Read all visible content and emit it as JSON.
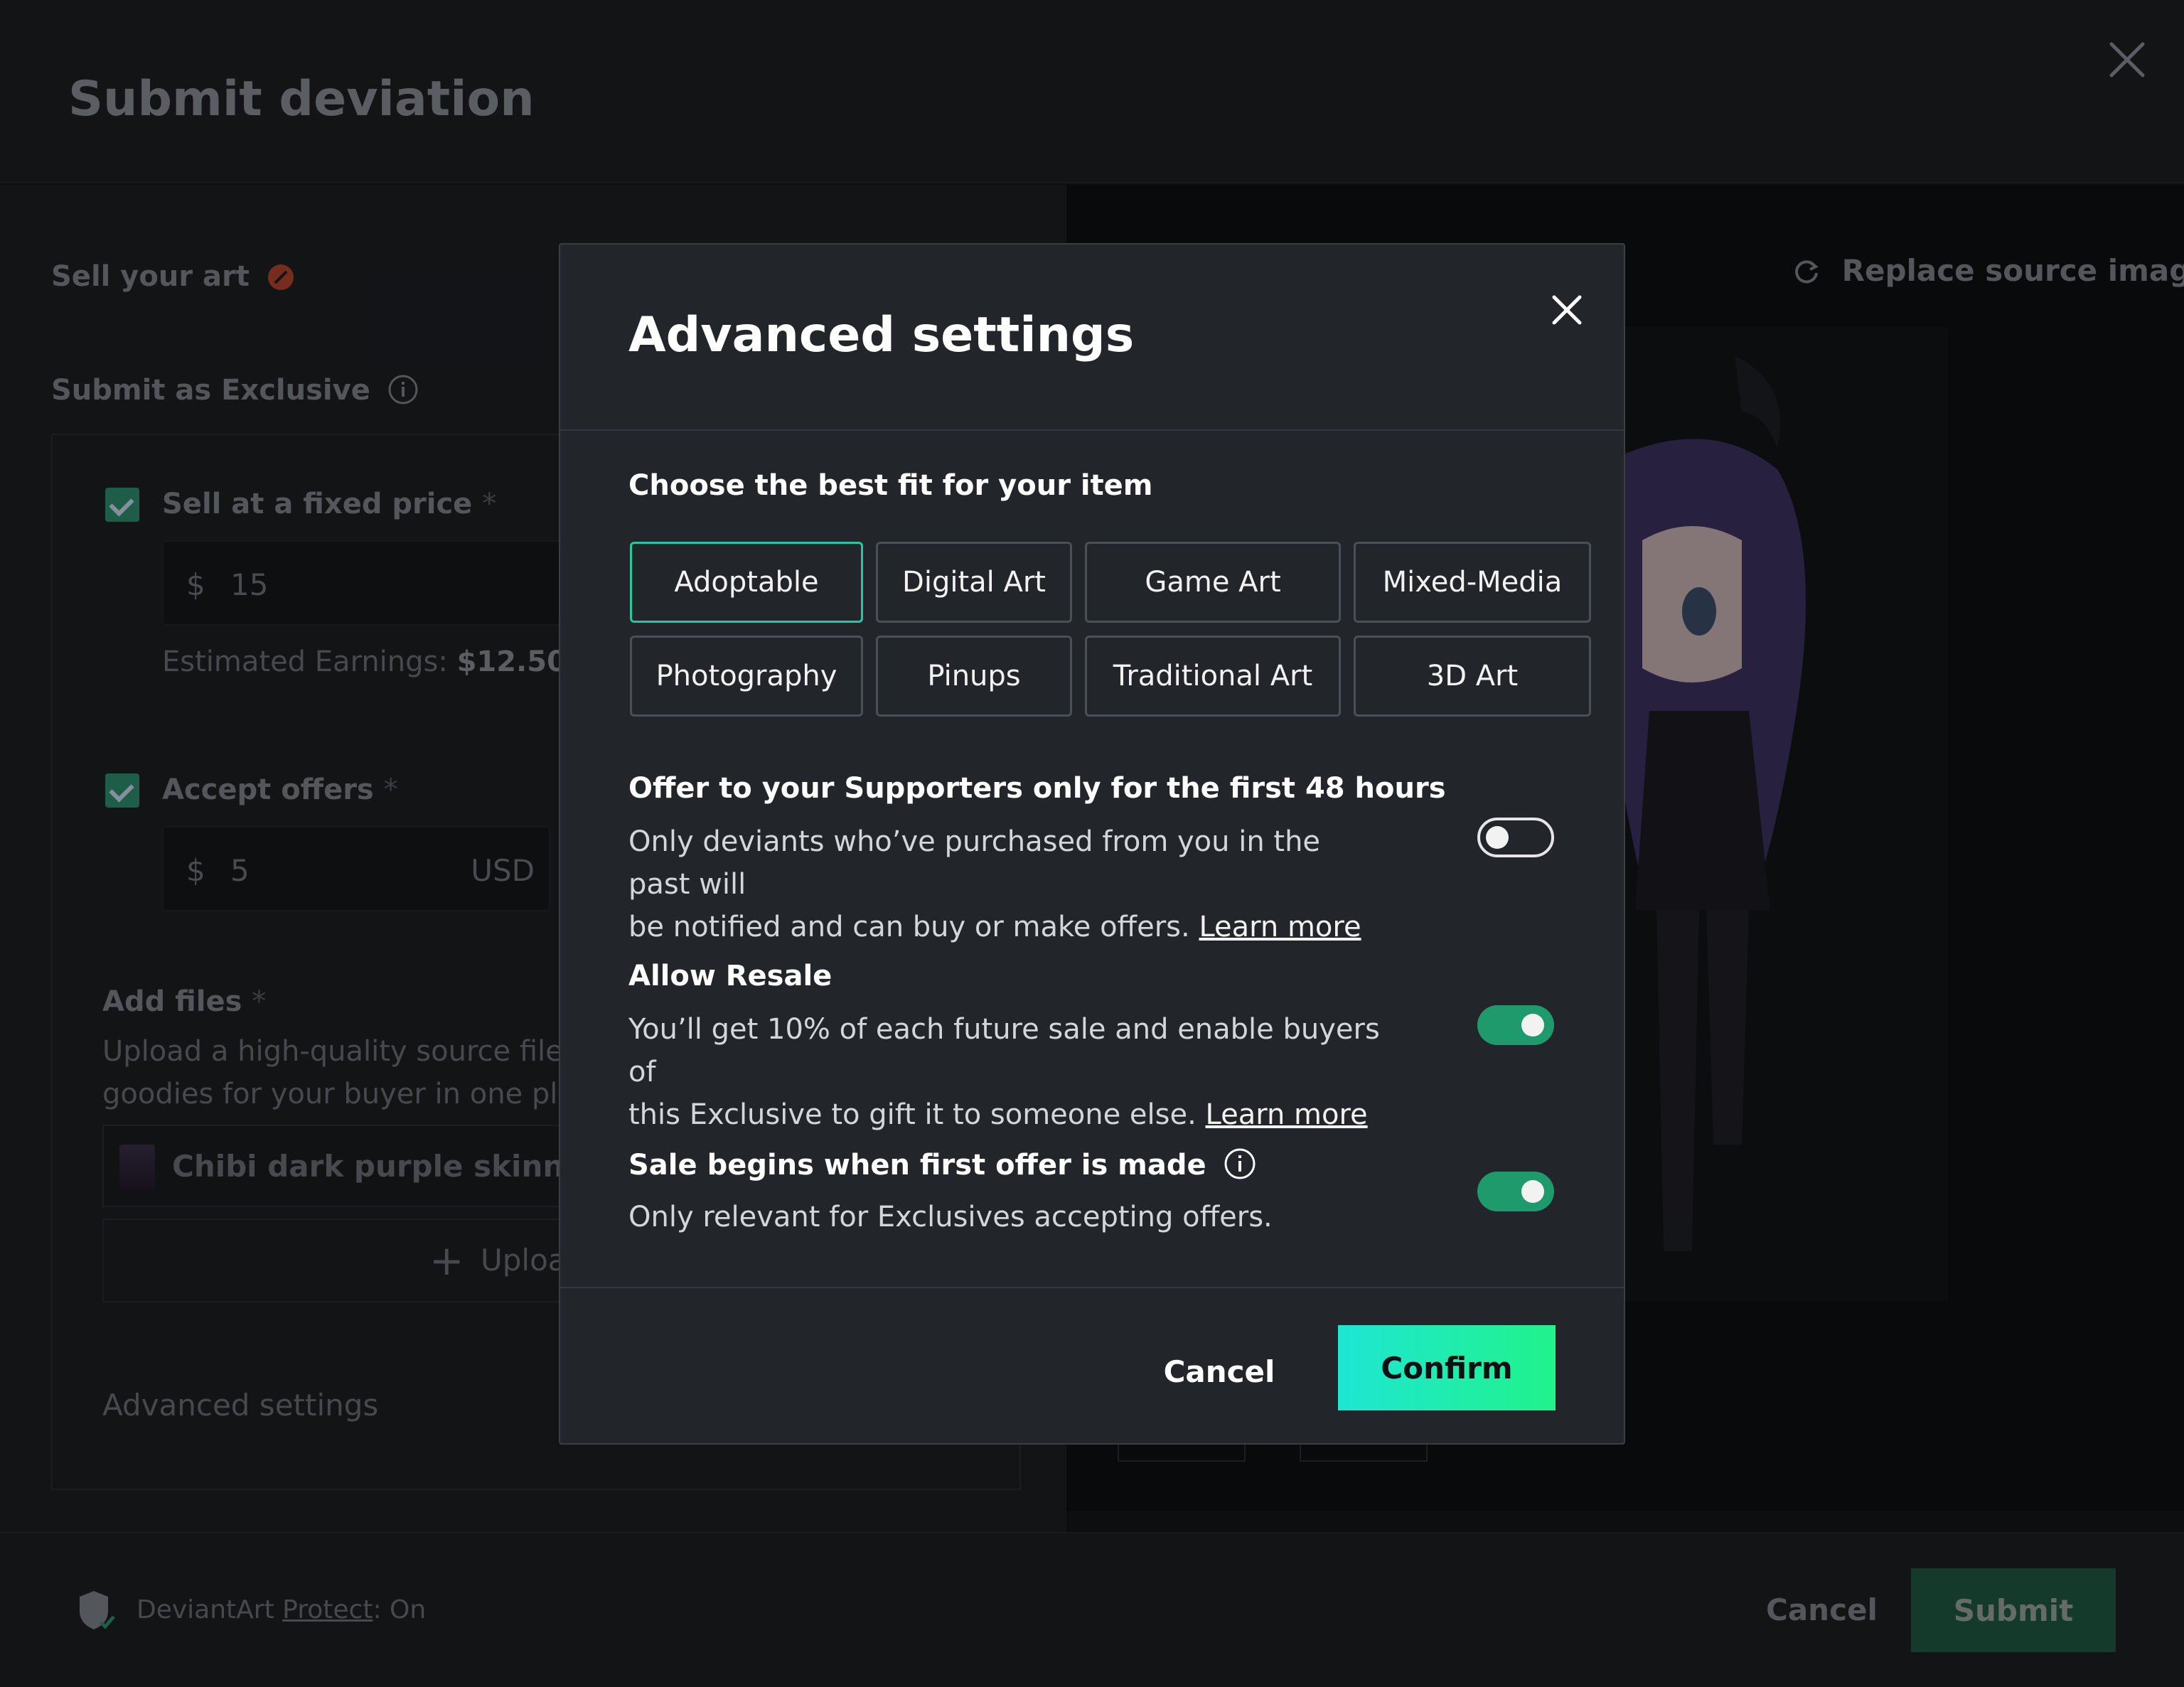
{
  "page": {
    "title": "Submit deviation",
    "sell_label": "Sell your art",
    "exclusive_label": "Submit as Exclusive",
    "fixed_price_label": "Sell at a fixed price",
    "price_currency": "$",
    "price_value": "15",
    "earnings_label": "Estimated Earnings:",
    "earnings_value": "$12.50",
    "offers_label": "Accept offers",
    "offer_currency": "$",
    "offer_value": "5",
    "offer_unit": "USD",
    "required_mark": "*",
    "add_files_label": "Add files",
    "add_files_desc_1": "Upload a high-quality source file li",
    "add_files_desc_2": "goodies for your buyer in one plac",
    "file_name": "Chibi dark purple skinned de",
    "upload_label": "Uploa",
    "advanced_link": "Advanced settings",
    "replace_label": "Replace source image",
    "protect_prefix": "DeviantArt",
    "protect_link": "Protect",
    "protect_suffix": ": On",
    "footer_cancel": "Cancel",
    "footer_submit": "Submit"
  },
  "modal": {
    "title": "Advanced settings",
    "category_heading": "Choose the best fit for your item",
    "categories": [
      "Adoptable",
      "Digital Art",
      "Game Art",
      "Mixed-Media",
      "Photography",
      "Pinups",
      "Traditional Art",
      "3D Art"
    ],
    "selected_category": "Adoptable",
    "options": [
      {
        "title": "Offer to your Supporters only for the first 48 hours",
        "desc_1": "Only deviants who’ve purchased from you in the past will",
        "desc_2": "be notified and can buy or make offers.",
        "link": "Learn more",
        "enabled": false
      },
      {
        "title": "Allow Resale",
        "desc_1": "You’ll get 10% of each future sale and enable buyers of",
        "desc_2": "this Exclusive to gift it to someone else.",
        "link": "Learn more",
        "enabled": true
      },
      {
        "title": "Sale begins when first offer is made",
        "desc_1": "Only relevant for Exclusives accepting offers.",
        "enabled": true
      }
    ],
    "cancel_label": "Cancel",
    "confirm_label": "Confirm"
  }
}
